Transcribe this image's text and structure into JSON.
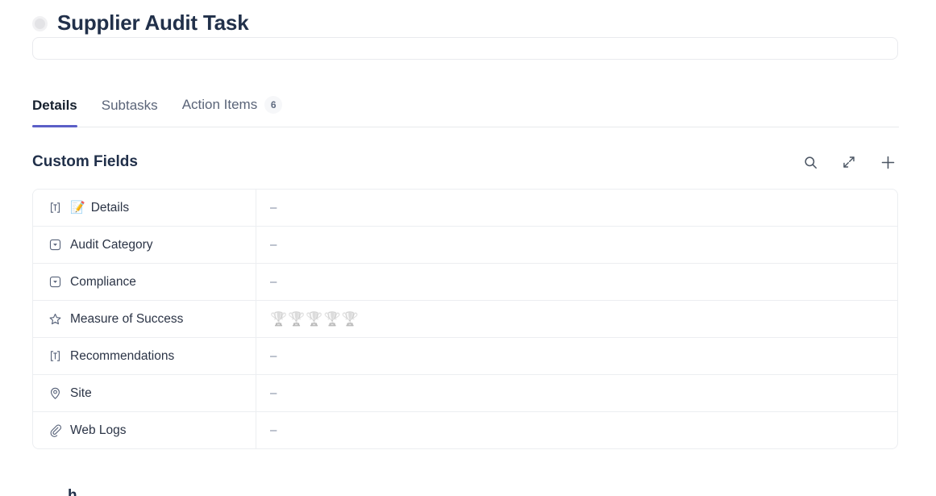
{
  "header": {
    "status_icon": "status-circle-icon",
    "title": "Supplier Audit Task"
  },
  "tabs": [
    {
      "label": "Details",
      "active": true,
      "badge": ""
    },
    {
      "label": "Subtasks",
      "active": false,
      "badge": ""
    },
    {
      "label": "Action Items",
      "active": false,
      "badge": "6"
    }
  ],
  "section": {
    "title": "Custom Fields",
    "actions": [
      {
        "name": "search-icon",
        "label": "Search"
      },
      {
        "name": "expand-icon",
        "label": "Expand"
      },
      {
        "name": "plus-icon",
        "label": "Add field"
      }
    ]
  },
  "custom_fields": {
    "rows": [
      {
        "icon": "text-field-icon",
        "emoji": "📝",
        "name": "Details",
        "value": "–",
        "value_type": "dash"
      },
      {
        "icon": "dropdown-field-icon",
        "emoji": "",
        "name": "Audit Category",
        "value": "–",
        "value_type": "dash"
      },
      {
        "icon": "dropdown-field-icon",
        "emoji": "",
        "name": "Compliance",
        "value": "–",
        "value_type": "dash"
      },
      {
        "icon": "star-field-icon",
        "emoji": "",
        "name": "Measure of Success",
        "value": "",
        "value_type": "rating",
        "rating_icon": "🏆",
        "rating_max": 5,
        "rating_value": 0
      },
      {
        "icon": "text-field-icon",
        "emoji": "",
        "name": "Recommendations",
        "value": "–",
        "value_type": "dash"
      },
      {
        "icon": "location-field-icon",
        "emoji": "",
        "name": "Site",
        "value": "–",
        "value_type": "dash"
      },
      {
        "icon": "attachment-field-icon",
        "emoji": "",
        "name": "Web Logs",
        "value": "–",
        "value_type": "dash"
      }
    ]
  },
  "colors": {
    "accent": "#5b5fc7",
    "title": "#21304a",
    "muted": "#5a6478",
    "border": "#eceef1"
  },
  "bottom_partial_heading": "h"
}
